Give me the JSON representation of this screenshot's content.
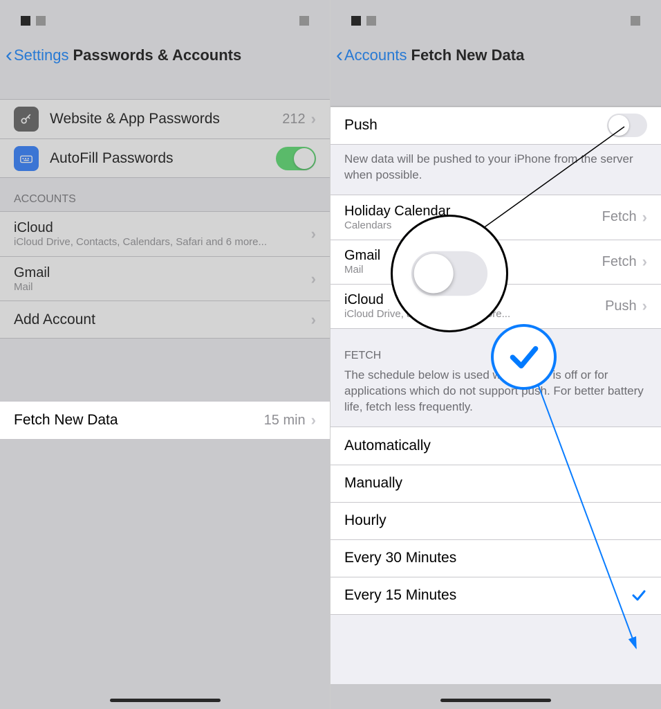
{
  "left": {
    "back": "Settings",
    "title": "Passwords & Accounts",
    "row_passwords": {
      "label": "Website & App Passwords",
      "count": "212"
    },
    "row_autofill": {
      "label": "AutoFill Passwords"
    },
    "accounts_header": "ACCOUNTS",
    "acct_icloud": {
      "label": "iCloud",
      "sub": "iCloud Drive, Contacts, Calendars, Safari and 6 more..."
    },
    "acct_gmail": {
      "label": "Gmail",
      "sub": "Mail"
    },
    "acct_add": "Add Account",
    "fetch_row": {
      "label": "Fetch New Data",
      "value": "15 min"
    }
  },
  "right": {
    "back": "Accounts",
    "title": "Fetch New Data",
    "push_label": "Push",
    "push_footer": "New data will be pushed to your iPhone from the server when possible.",
    "acct_holiday": {
      "label": "Holiday Calendar",
      "sub": "Calendars",
      "value": "Fetch"
    },
    "acct_gmail": {
      "label": "Gmail",
      "sub": "Mail",
      "value": "Fetch"
    },
    "acct_icloud": {
      "label": "iCloud",
      "sub": "iCloud Drive,           alendars and 7 more...",
      "value": "Push"
    },
    "fetch_header": "FETCH",
    "fetch_footer": "The schedule below is used when push is off or for applications which do not support push. For better battery life, fetch less frequently.",
    "opt1": "Automatically",
    "opt2": "Manually",
    "opt3": "Hourly",
    "opt4": "Every 30 Minutes",
    "opt5": "Every 15 Minutes"
  }
}
